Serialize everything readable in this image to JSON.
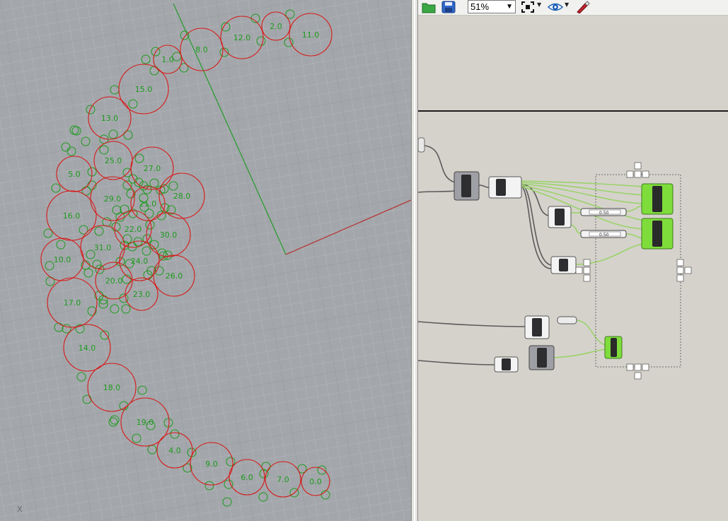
{
  "viewport": {
    "axis_label": "X",
    "circle_labels": [
      "0.0",
      "1.0",
      "2.0",
      "4.0",
      "5.0",
      "6.0",
      "7.0",
      "8.0",
      "9.0",
      "10.0",
      "11.0",
      "12.0",
      "13.0",
      "14.0",
      "15.0",
      "16.0",
      "17.0",
      "18.0",
      "19.0",
      "20.0",
      "21.0",
      "22.0",
      "23.0",
      "24.0",
      "25.0",
      "26.0",
      "27.0",
      "28.0",
      "29.0",
      "30.0",
      "31.0"
    ]
  },
  "grasshopper": {
    "toolbar": {
      "zoom_value": "51%",
      "icons": [
        "open-file-icon",
        "save-icon",
        "zoom-extents-icon",
        "preview-eye-icon",
        "sketch-pen-icon"
      ]
    },
    "sliders": [
      "0.50",
      "0.50"
    ]
  },
  "colors": {
    "circle_stroke": "#d81818",
    "small_circle_stroke": "#1e9a1e",
    "label": "#1f9a1f",
    "wire_green": "#9ad36a",
    "component_green": "#7fdd3b"
  }
}
